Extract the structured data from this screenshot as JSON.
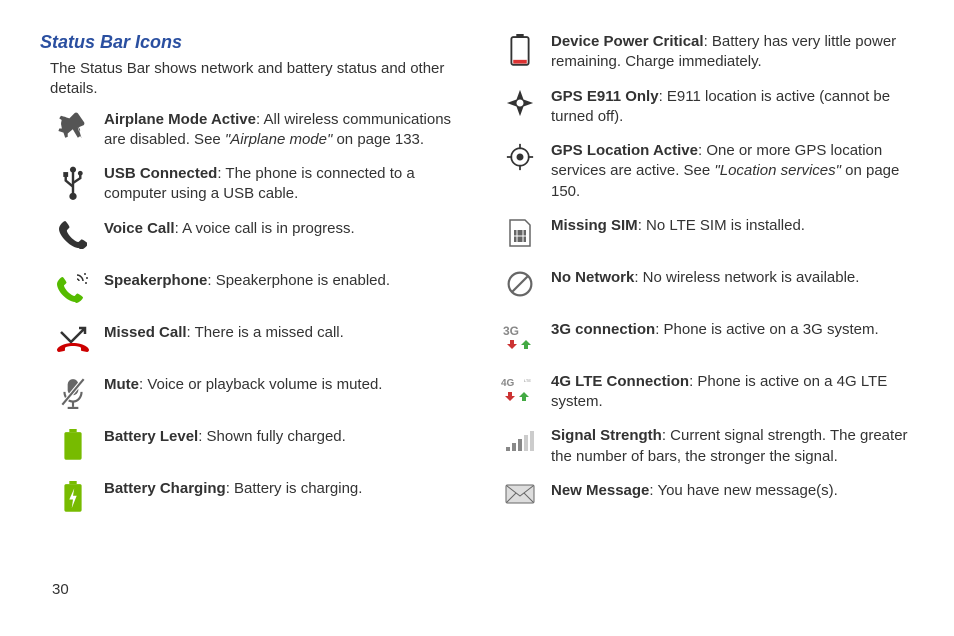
{
  "heading": "Status Bar Icons",
  "intro": "The Status Bar shows network and battery status and other details.",
  "page_number": "30",
  "left": [
    {
      "title": "Airplane Mode Active",
      "desc": ": All wireless communications are disabled. See ",
      "ref": "\"Airplane mode\"",
      "tail": " on page 133."
    },
    {
      "title": "USB Connected",
      "desc": ": The phone is connected to a computer using a USB cable."
    },
    {
      "title": "Voice Call",
      "desc": ": A voice call is in progress."
    },
    {
      "title": "Speakerphone",
      "desc": ": Speakerphone is enabled."
    },
    {
      "title": "Missed Call",
      "desc": ": There is a missed call."
    },
    {
      "title": "Mute",
      "desc": ": Voice or playback volume is muted."
    },
    {
      "title": "Battery Level",
      "desc": ": Shown fully charged."
    },
    {
      "title": "Battery Charging",
      "desc": ": Battery is charging."
    }
  ],
  "right": [
    {
      "title": "Device Power Critical",
      "desc": ": Battery has very little power remaining. Charge immediately."
    },
    {
      "title": "GPS E911 Only",
      "desc": ": E911 location is active (cannot be turned off)."
    },
    {
      "title": "GPS Location Active",
      "desc": ": One or more GPS location services are active. See ",
      "ref": "\"Location services\"",
      "tail": " on page 150."
    },
    {
      "title": "Missing SIM",
      "desc": ": No LTE SIM is installed."
    },
    {
      "title": "No Network",
      "desc": ": No wireless network is available."
    },
    {
      "title": "3G connection",
      "desc": ": Phone is active on a 3G system."
    },
    {
      "title": "4G LTE Connection",
      "desc": ": Phone is active on a 4G LTE system."
    },
    {
      "title": "Signal Strength",
      "desc": ": Current signal strength. The greater the number of bars, the stronger the signal."
    },
    {
      "title": "New Message",
      "desc": ": You have new message(s)."
    }
  ]
}
